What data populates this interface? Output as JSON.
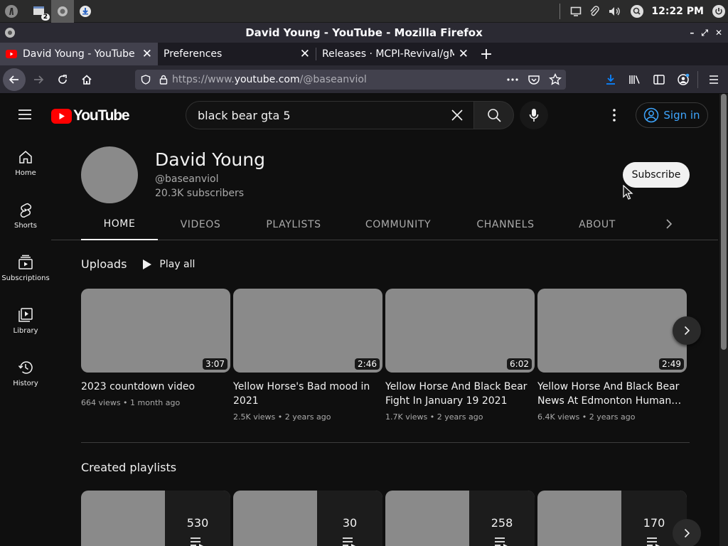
{
  "taskbar": {
    "badge_count": "2",
    "clock": "12:22 PM"
  },
  "window": {
    "title": "David Young - YouTube - Mozilla Firefox",
    "controls": [
      "–",
      "⤢",
      "✕"
    ]
  },
  "tabs": [
    {
      "label": "David Young - YouTube",
      "active": true
    },
    {
      "label": "Preferences",
      "active": false
    },
    {
      "label": "Releases · MCPI-Revival/gMCPI",
      "active": false
    }
  ],
  "urlbar": {
    "prefix": "https://www.",
    "host": "youtube.com",
    "path": "/@baseanviol"
  },
  "youtube": {
    "logo_text": "YouTube",
    "search_query": "black bear gta 5",
    "sign_in": "Sign in",
    "guide": [
      {
        "label": "Home",
        "icon": "home-icon"
      },
      {
        "label": "Shorts",
        "icon": "shorts-icon"
      },
      {
        "label": "Subscriptions",
        "icon": "subscriptions-icon"
      },
      {
        "label": "Library",
        "icon": "library-icon"
      },
      {
        "label": "History",
        "icon": "history-icon"
      }
    ],
    "channel": {
      "name": "David Young",
      "handle": "@baseanviol",
      "subscribers": "20.3K subscribers",
      "subscribe_label": "Subscribe"
    },
    "channel_tabs": [
      "HOME",
      "VIDEOS",
      "PLAYLISTS",
      "COMMUNITY",
      "CHANNELS",
      "ABOUT"
    ],
    "uploads": {
      "title": "Uploads",
      "play_all": "Play all",
      "videos": [
        {
          "title": "2023 countdown video",
          "duration": "3:07",
          "meta": "664 views • 1 month ago"
        },
        {
          "title": "Yellow Horse's Bad mood in 2021",
          "duration": "2:46",
          "meta": "2.5K views • 2 years ago"
        },
        {
          "title": "Yellow Horse And Black Bear Fight In January 19 2021",
          "duration": "6:02",
          "meta": "1.7K views • 2 years ago"
        },
        {
          "title": "Yellow Horse And Black Bear News At Edmonton Human…",
          "duration": "2:49",
          "meta": "6.4K views • 2 years ago"
        }
      ]
    },
    "playlists": {
      "title": "Created playlists",
      "items": [
        {
          "count": "530"
        },
        {
          "count": "30"
        },
        {
          "count": "258"
        },
        {
          "count": "170"
        }
      ]
    }
  },
  "colors": {
    "youtube_red": "#ff0000",
    "link_blue": "#3ea6ff",
    "download_blue": "#0a84ff"
  }
}
